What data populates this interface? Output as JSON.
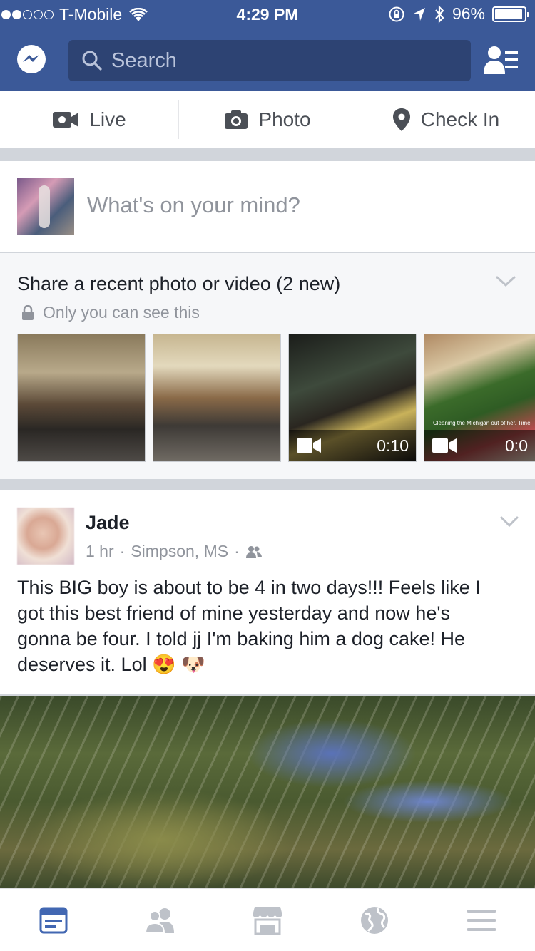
{
  "status_bar": {
    "carrier": "T-Mobile",
    "time": "4:29 PM",
    "battery": "96%",
    "battery_level": 0.96
  },
  "header": {
    "search_placeholder": "Search"
  },
  "composer_actions": [
    {
      "label": "Live",
      "icon": "video-camera-icon"
    },
    {
      "label": "Photo",
      "icon": "camera-icon"
    },
    {
      "label": "Check In",
      "icon": "location-pin-icon"
    }
  ],
  "composer": {
    "placeholder": "What's on your mind?"
  },
  "recent_media": {
    "title": "Share a recent photo or video (2 new)",
    "privacy": "Only you can see this",
    "items": [
      {
        "type": "photo"
      },
      {
        "type": "photo"
      },
      {
        "type": "video",
        "duration": "0:10"
      },
      {
        "type": "video",
        "duration": "0:0",
        "caption": "Cleaning the Michigan out of her. Time"
      }
    ]
  },
  "post": {
    "author": "Jade",
    "time": "1 hr",
    "location": "Simpson, MS",
    "text_lines": [
      "This BIG boy is about to be 4 in two days!!! Feels like I",
      "got this best friend of mine yesterday and now he's",
      "gonna be four. I told jj I'm baking him a dog cake! He",
      "deserves it. Lol 😍 🐶"
    ]
  },
  "tab_bar": [
    {
      "icon": "news-feed-icon",
      "active": true
    },
    {
      "icon": "friends-icon",
      "active": false
    },
    {
      "icon": "marketplace-icon",
      "active": false
    },
    {
      "icon": "globe-icon",
      "active": false
    },
    {
      "icon": "menu-icon",
      "active": false
    }
  ],
  "colors": {
    "brand": "#3b5998",
    "active_tab": "#4267b2",
    "inactive_tab": "#bec2c9"
  }
}
